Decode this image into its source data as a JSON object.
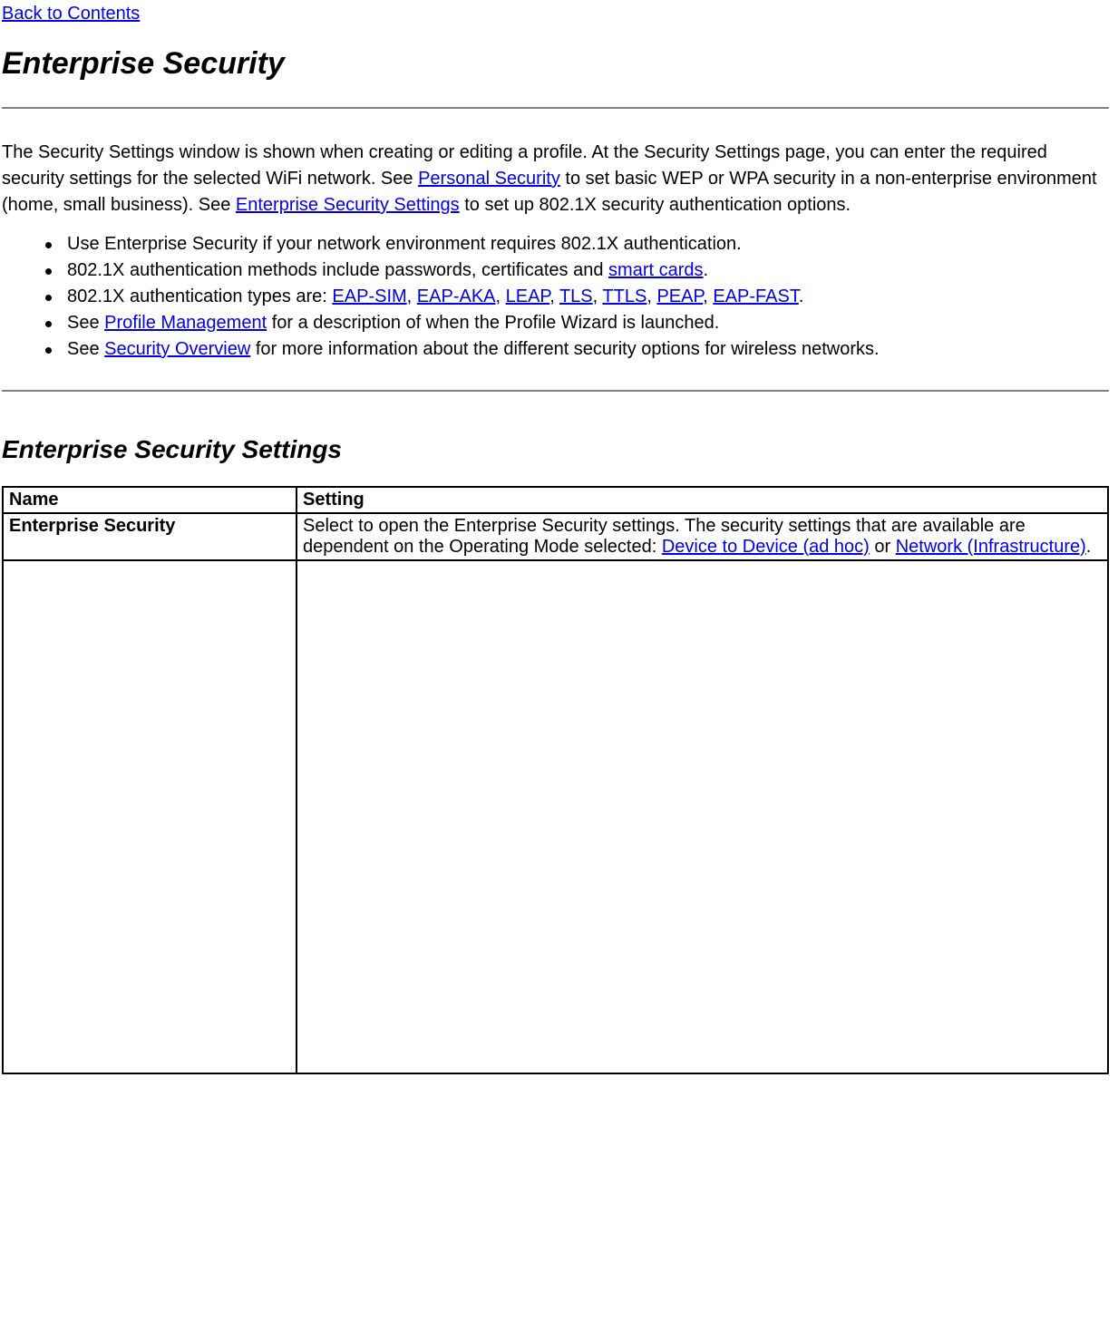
{
  "nav": {
    "back_link": "Back to Contents"
  },
  "title": "Enterprise Security",
  "intro": {
    "part1": "The Security Settings window is shown when creating or editing a profile. At the Security Settings page, you can enter the required security settings for the selected WiFi network. See ",
    "link_personal": "Personal Security",
    "part2": " to set basic WEP or WPA security in a non-enterprise environment (home, small business). See ",
    "link_enterprise": "Enterprise Security Settings",
    "part3": " to set up 802.1X security authentication options."
  },
  "bullets": {
    "b1": "Use Enterprise Security if your network environment requires 802.1X authentication.",
    "b2_a": "802.1X authentication methods include passwords, certificates and ",
    "b2_link_smartcards": "smart cards",
    "b2_b": ".",
    "b3_a": "802.1X authentication types are: ",
    "b3_l1": "EAP-SIM",
    "b3_s": ", ",
    "b3_l2": "EAP-AKA",
    "b3_l3": "LEAP",
    "b3_l4": "TLS",
    "b3_l5": "TTLS",
    "b3_l6": "PEAP",
    "b3_l7": "EAP-FAST",
    "b3_end": ".",
    "b4_a": "See ",
    "b4_link": "Profile Management",
    "b4_b": " for a description of when the Profile Wizard is launched.",
    "b5_a": "See ",
    "b5_link": "Security Overview",
    "b5_b": " for more information about the different security options for wireless networks."
  },
  "section2_title": "Enterprise Security Settings",
  "table": {
    "headers": {
      "name": "Name",
      "setting": "Setting"
    },
    "row1": {
      "name": "Enterprise Security",
      "setting_a": "Select to open the Enterprise Security settings. The security settings that are available are dependent on the Operating Mode selected: ",
      "link_adhoc": "Device to Device (ad hoc)",
      "setting_mid": " or ",
      "link_infra": "Network (Infrastructure)",
      "setting_end": "."
    }
  }
}
